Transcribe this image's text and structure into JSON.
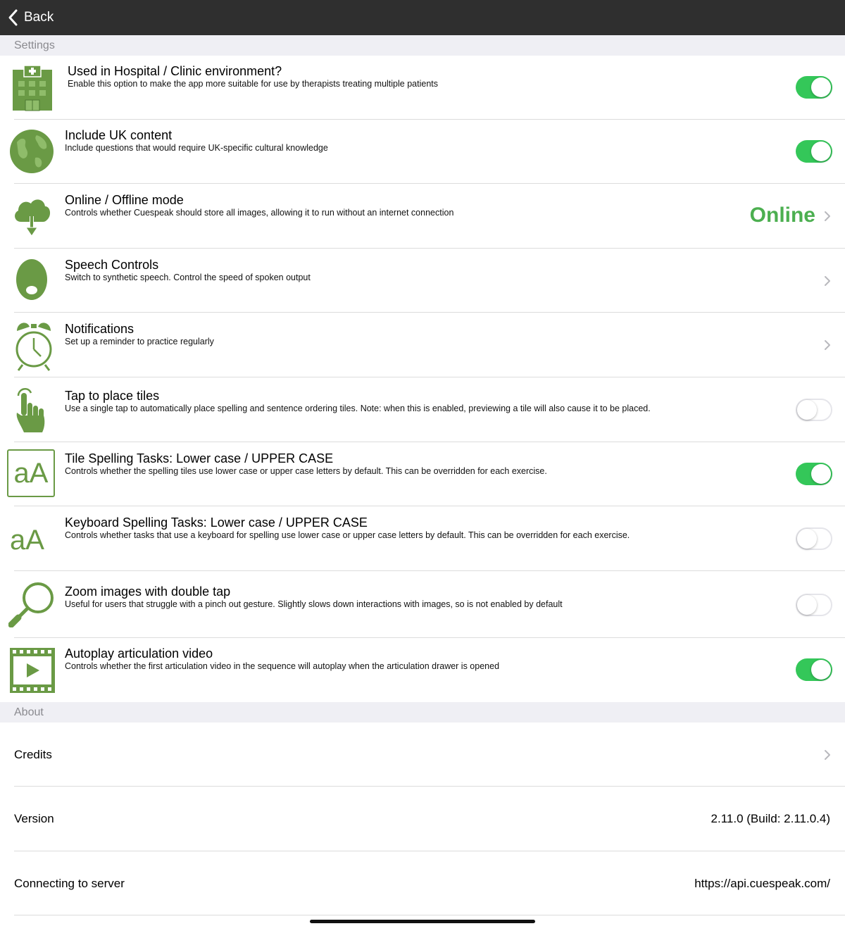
{
  "nav": {
    "back_label": "Back"
  },
  "settings_header": "Settings",
  "settings": [
    {
      "title": "Used in Hospital / Clinic environment?",
      "description": "Enable this option to make the app more suitable for use by therapists treating multiple patients",
      "icon": "hospital-icon",
      "control": "toggle",
      "on": true
    },
    {
      "title": "Include UK content",
      "description": "Include questions that would require UK-specific cultural knowledge",
      "icon": "globe-icon",
      "control": "toggle",
      "on": true
    },
    {
      "title": "Online / Offline mode",
      "description": "Controls whether Cuespeak should store all images, allowing it to run without an internet connection",
      "icon": "cloud-download-icon",
      "control": "value",
      "value": "Online"
    },
    {
      "title": "Speech Controls",
      "description": "Switch to synthetic speech. Control the speed of spoken output",
      "icon": "mouth-icon",
      "control": "chevron"
    },
    {
      "title": "Notifications",
      "description": "Set up a reminder to practice regularly",
      "icon": "alarm-clock-icon",
      "control": "chevron"
    },
    {
      "title": "Tap to place tiles",
      "description": "Use a single tap to automatically place spelling and sentence ordering tiles. Note: when this is enabled, previewing a tile will also cause it to be placed.",
      "icon": "tap-hand-icon",
      "control": "toggle",
      "on": false
    },
    {
      "title": "Tile Spelling Tasks: Lower case / UPPER CASE",
      "description": "Controls whether the spelling tiles use lower case or upper case letters by default. This can be overridden for each exercise.",
      "icon": "letter-case-tile-icon",
      "icon_text": "aA",
      "control": "toggle",
      "on": true
    },
    {
      "title": "Keyboard Spelling Tasks: Lower case / UPPER CASE",
      "description": "Controls whether tasks that use a keyboard for spelling use lower case or upper case letters by default. This can be overridden for each exercise.",
      "icon": "letter-case-keyboard-icon",
      "icon_text": "aA",
      "control": "toggle",
      "on": false
    },
    {
      "title": "Zoom images with double tap",
      "description": "Useful for users that struggle with a pinch out gesture. Slightly slows down interactions with images, so is not enabled by default",
      "icon": "magnifier-icon",
      "control": "toggle",
      "on": false
    },
    {
      "title": "Autoplay articulation video",
      "description": "Controls whether the first articulation video in the sequence will autoplay when the articulation drawer is opened",
      "icon": "video-play-icon",
      "control": "toggle",
      "on": true
    }
  ],
  "about_header": "About",
  "about": [
    {
      "label": "Credits",
      "control": "chevron"
    },
    {
      "label": "Version",
      "value": "2.11.0 (Build: 2.11.0.4)"
    },
    {
      "label": "Connecting to server",
      "value": "https://api.cuespeak.com/"
    }
  ],
  "colors": {
    "accent_green": "#6a9a45",
    "toggle_on": "#34c759",
    "online_text": "#4caf50",
    "nav_bg": "#2f2f2f",
    "section_bg": "#efeff4"
  }
}
